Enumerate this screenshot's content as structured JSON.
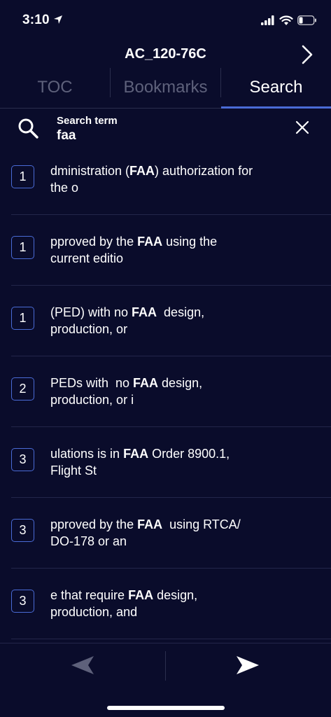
{
  "status_bar": {
    "time": "3:10"
  },
  "header": {
    "title": "AC_120-76C"
  },
  "tabs": [
    {
      "label": "TOC",
      "active": false
    },
    {
      "label": "Bookmarks",
      "active": false
    },
    {
      "label": "Search",
      "active": true
    }
  ],
  "search": {
    "label": "Search term",
    "value": "faa"
  },
  "results": [
    {
      "page": "1",
      "before": "dministration (",
      "match": "FAA",
      "after": ") authorization for\nthe o"
    },
    {
      "page": "1",
      "before": "pproved by the ",
      "match": "FAA",
      "after": " using the\ncurrent editio"
    },
    {
      "page": "1",
      "before": "(PED) with no ",
      "match": "FAA",
      "after": "  design,\nproduction, or"
    },
    {
      "page": "2",
      "before": "PEDs with  no ",
      "match": "FAA",
      "after": " design,\nproduction, or i"
    },
    {
      "page": "3",
      "before": "ulations is in ",
      "match": "FAA",
      "after": " Order 8900.1,\nFlight St"
    },
    {
      "page": "3",
      "before": "pproved by the ",
      "match": "FAA",
      "after": "  using RTCA/\nDO-178 or an"
    },
    {
      "page": "3",
      "before": "e that require ",
      "match": "FAA",
      "after": " design,\nproduction, and"
    }
  ],
  "colors": {
    "background": "#0a0c2b",
    "accent": "#4a6bd6",
    "inactive_tab": "#5e617b"
  }
}
